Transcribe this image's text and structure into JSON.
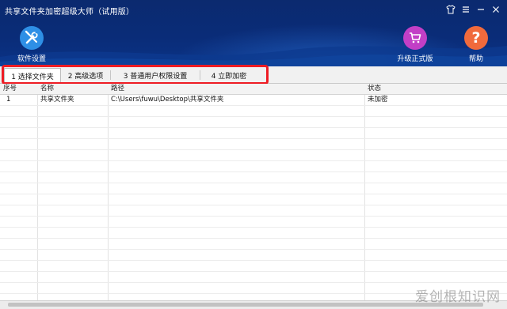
{
  "window": {
    "title": "共享文件夹加密超级大师（试用版）",
    "controls": [
      "shirt-skin-icon",
      "menu-icon",
      "minimize-icon",
      "close-icon"
    ]
  },
  "toolbar": {
    "settings_label": "软件设置",
    "upgrade_label": "升级正式版",
    "help_label": "帮助",
    "colors": {
      "settings": "#2e8fe6",
      "upgrade": "#c23fc6",
      "help": "#f06a3c"
    }
  },
  "tabs": [
    {
      "label": "1 选择文件夹",
      "active": true
    },
    {
      "label": "2 高级选项",
      "active": false
    },
    {
      "label": "3 普通用户权限设置",
      "active": false
    },
    {
      "label": "4 立即加密",
      "active": false
    }
  ],
  "table": {
    "columns": [
      "序号",
      "名称",
      "路径",
      "状态"
    ],
    "rows": [
      {
        "index": "1",
        "name": "共享文件夹",
        "path": "C:\\Users\\fuwu\\Desktop\\共享文件夹",
        "status": "未加密"
      }
    ]
  },
  "highlight_color": "#ee1c24",
  "watermark": "爱创根知识网"
}
